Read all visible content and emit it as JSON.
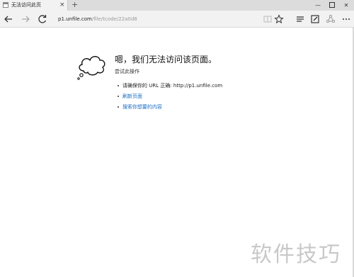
{
  "browser": {
    "tab": {
      "title": "无法访问此页",
      "close_glyph": "×"
    },
    "new_tab_glyph": "+",
    "window_controls": {
      "minimize": "—",
      "close": "✕"
    },
    "address": {
      "host": "p1.unfile.com",
      "path": "/file/tcode/22a0d8"
    },
    "icons": {
      "back": "back-arrow-icon",
      "forward": "forward-arrow-icon",
      "refresh": "refresh-icon",
      "reading_view": "reading-view-icon",
      "favorite": "star-icon",
      "hub": "hub-icon",
      "web_note": "web-note-icon",
      "share": "share-icon",
      "more": "more-icon"
    }
  },
  "error_page": {
    "heading": "嗯，我们无法访问该页面。",
    "subheading": "尝试此操作",
    "suggestions": [
      {
        "text": "请确保你的 URL 正确: http://p1.unfile.com",
        "is_link": false
      },
      {
        "text": "刷新页面",
        "is_link": true
      },
      {
        "text": "搜索你想要的内容",
        "is_link": true
      }
    ]
  },
  "watermark": "软件技巧",
  "colors": {
    "link": "#1a6cc4",
    "tab_bar": "#dcdcdc",
    "nav_bar": "#f2f2f2"
  }
}
